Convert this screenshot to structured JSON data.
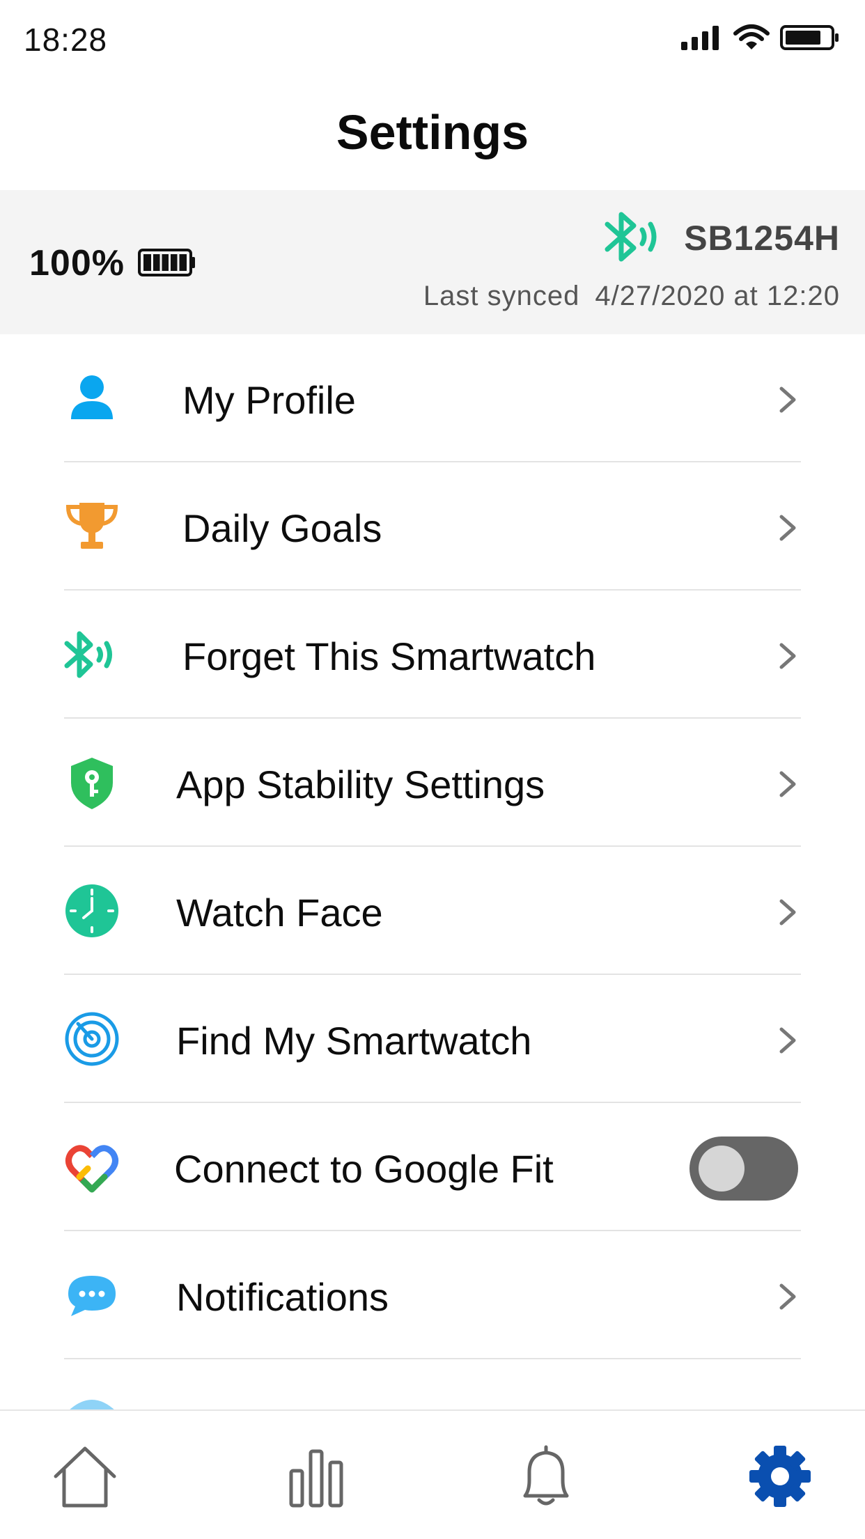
{
  "status_bar": {
    "time": "18:28"
  },
  "header": {
    "title": "Settings"
  },
  "device": {
    "battery_percent": "100%",
    "battery_level": 1.0,
    "name": "SB1254H",
    "last_synced_label": "Last synced",
    "last_synced_value": "4/27/2020 at 12:20"
  },
  "menu": {
    "items": [
      {
        "label": "My Profile",
        "icon": "person-icon"
      },
      {
        "label": "Daily Goals",
        "icon": "trophy-icon"
      },
      {
        "label": "Forget This Smartwatch",
        "icon": "bluetooth-icon"
      },
      {
        "label": "App Stability Settings",
        "icon": "shield-key-icon"
      },
      {
        "label": "Watch Face",
        "icon": "clock-icon"
      },
      {
        "label": "Find My Smartwatch",
        "icon": "radar-icon"
      },
      {
        "label": "Connect to Google Fit",
        "icon": "google-fit-icon",
        "toggle_on": false
      },
      {
        "label": "Notifications",
        "icon": "chat-bubble-icon"
      }
    ]
  },
  "tab_bar": {
    "tabs": [
      {
        "name": "home",
        "icon": "home-icon",
        "active": false
      },
      {
        "name": "stats",
        "icon": "bar-chart-icon",
        "active": false
      },
      {
        "name": "alerts",
        "icon": "bell-icon",
        "active": false
      },
      {
        "name": "settings",
        "icon": "gear-icon",
        "active": true
      }
    ]
  },
  "colors": {
    "accent_green": "#1fc596",
    "active_blue": "#0a4fb0",
    "profile_blue": "#0aa6ef",
    "trophy_orange": "#f29a30",
    "shield_green": "#2fbf5d",
    "toggle_track": "#666666"
  }
}
